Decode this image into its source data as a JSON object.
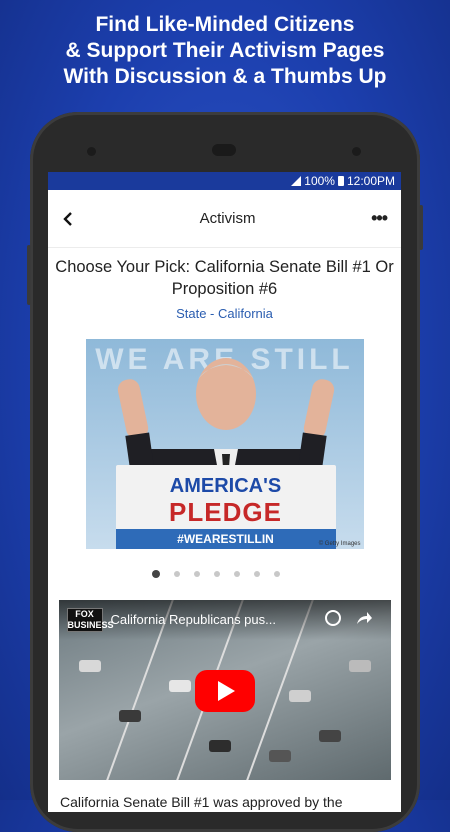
{
  "promo": {
    "line1": "Find Like-Minded Citizens",
    "line2": "& Support Their Activism Pages",
    "line3": "With Discussion & a Thumbs Up"
  },
  "status_bar": {
    "battery": "100%",
    "time": "12:00PM"
  },
  "app_bar": {
    "title": "Activism",
    "back_icon": "chevron-left-icon",
    "more_icon": "more-horizontal-icon",
    "more_glyph": "•••"
  },
  "article": {
    "title": "Choose Your Pick: California Senate Bill #1 Or Proposition #6",
    "location": "State - California",
    "photo": {
      "background_text": "WE ARE STILL",
      "podium_line1": "AMERICA'S",
      "podium_line2": "PLEDGE",
      "podium_tag": "#WEARESTILLIN",
      "credit": "© Getty Images"
    },
    "carousel": {
      "total": 7,
      "active_index": 0
    },
    "video": {
      "channel_logo": "FOX BUSINESS",
      "title": "California Republicans pus...",
      "watch_later_icon": "clock-icon",
      "share_icon": "share-icon",
      "play_icon": "play-icon"
    },
    "body_preview": "California Senate Bill #1 was approved by the"
  },
  "colors": {
    "background": "#1c3fae",
    "status_bar": "#1a3a9c",
    "link": "#2a5db0",
    "play_button": "#ff0000"
  }
}
